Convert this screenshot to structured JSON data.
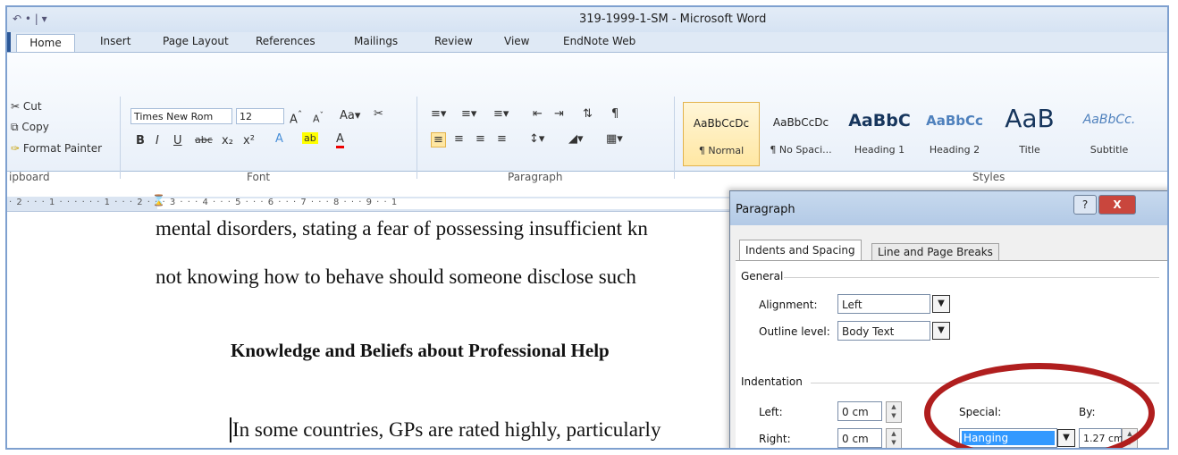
{
  "window": {
    "title": "319-1999-1-SM - Microsoft Word",
    "qat_text": "↶ • | ▾"
  },
  "tabs": [
    "Home",
    "Insert",
    "Page Layout",
    "References",
    "Mailings",
    "Review",
    "View",
    "EndNote Web"
  ],
  "clipboard": {
    "cut": "Cut",
    "copy": "Copy",
    "format_painter": "Format Painter",
    "group_label": "ipboard"
  },
  "font": {
    "name": "Times New Rom",
    "size": "12",
    "group_label": "Font"
  },
  "paragraph_group": {
    "label": "Paragraph"
  },
  "styles": {
    "group_label": "Styles",
    "items": [
      {
        "sample": "AaBbCcDc",
        "label": "¶ Normal"
      },
      {
        "sample": "AaBbCcDc",
        "label": "¶ No Spaci..."
      },
      {
        "sample": "AaBbC",
        "label": "Heading 1"
      },
      {
        "sample": "AaBbCc",
        "label": "Heading 2"
      },
      {
        "sample": "AaB",
        "label": "Title"
      },
      {
        "sample": "AaBbCc.",
        "label": "Subtitle"
      }
    ]
  },
  "ruler_text": "· 2 · · · 1 · · · · · · 1 · · · 2 · · · 3 · · · 4 · · · 5 · · · 6 · · · 7 · · · 8 · · · 9 · · 1",
  "document": {
    "line1": "mental disorders, stating a fear of possessing insufficient kn",
    "line2": "not knowing how to behave should someone disclose such",
    "heading": "Knowledge and Beliefs about Professional Help",
    "line3": "In some countries, GPs are rated highly, particularly"
  },
  "dialog": {
    "title": "Paragraph",
    "help": "?",
    "close": "X",
    "tab_indents": "Indents and Spacing",
    "tab_breaks": "Line and Page Breaks",
    "general_label": "General",
    "alignment_label": "Alignment:",
    "alignment_value": "Left",
    "outline_label": "Outline level:",
    "outline_value": "Body Text",
    "indentation_label": "Indentation",
    "left_label": "Left:",
    "left_value": "0 cm",
    "right_label": "Right:",
    "right_value": "0 cm",
    "special_label": "Special:",
    "special_value": "Hanging",
    "by_label": "By:",
    "by_value": "1.27 cm"
  }
}
